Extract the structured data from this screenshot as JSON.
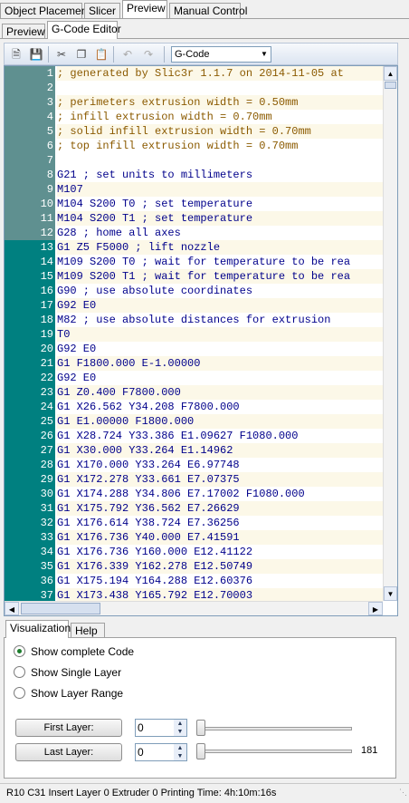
{
  "main_tabs": [
    {
      "label": "Object Placement"
    },
    {
      "label": "Slicer"
    },
    {
      "label": "Preview"
    },
    {
      "label": "Manual Control"
    }
  ],
  "sub_tabs": [
    {
      "label": "Preview"
    },
    {
      "label": "G-Code Editor"
    }
  ],
  "toolbar": {
    "icons": [
      "new-file",
      "save",
      "cut",
      "copy",
      "paste",
      "undo",
      "redo"
    ],
    "combo_value": "G-Code"
  },
  "editor": {
    "lines": [
      {
        "n": "1",
        "text": "; generated by Slic3r 1.1.7 on 2014-11-05 at"
      },
      {
        "n": "2",
        "text": ""
      },
      {
        "n": "3",
        "text": "; perimeters extrusion width = 0.50mm"
      },
      {
        "n": "4",
        "text": "; infill extrusion width = 0.70mm"
      },
      {
        "n": "5",
        "text": "; solid infill extrusion width = 0.70mm"
      },
      {
        "n": "6",
        "text": "; top infill extrusion width = 0.70mm"
      },
      {
        "n": "7",
        "text": ""
      },
      {
        "n": "8",
        "text": "G21 ; set units to millimeters"
      },
      {
        "n": "9",
        "text": "M107"
      },
      {
        "n": "10",
        "text": "M104 S200 T0 ; set temperature"
      },
      {
        "n": "11",
        "text": "M104 S200 T1 ; set temperature"
      },
      {
        "n": "12",
        "text": "G28 ; home all axes"
      },
      {
        "n": "13",
        "text": "G1 Z5 F5000 ; lift nozzle"
      },
      {
        "n": "14",
        "text": "M109 S200 T0 ; wait for temperature to be rea"
      },
      {
        "n": "15",
        "text": "M109 S200 T1 ; wait for temperature to be rea"
      },
      {
        "n": "16",
        "text": "G90 ; use absolute coordinates"
      },
      {
        "n": "17",
        "text": "G92 E0"
      },
      {
        "n": "18",
        "text": "M82 ; use absolute distances for extrusion"
      },
      {
        "n": "19",
        "text": "T0"
      },
      {
        "n": "20",
        "text": "G92 E0"
      },
      {
        "n": "21",
        "text": "G1 F1800.000 E-1.00000"
      },
      {
        "n": "22",
        "text": "G92 E0"
      },
      {
        "n": "23",
        "text": "G1 Z0.400 F7800.000"
      },
      {
        "n": "24",
        "text": "G1 X26.562 Y34.208 F7800.000"
      },
      {
        "n": "25",
        "text": "G1 E1.00000 F1800.000"
      },
      {
        "n": "26",
        "text": "G1 X28.724 Y33.386 E1.09627 F1080.000"
      },
      {
        "n": "27",
        "text": "G1 X30.000 Y33.264 E1.14962"
      },
      {
        "n": "28",
        "text": "G1 X170.000 Y33.264 E6.97748"
      },
      {
        "n": "29",
        "text": "G1 X172.278 Y33.661 E7.07375"
      },
      {
        "n": "30",
        "text": "G1 X174.288 Y34.806 E7.17002 F1080.000"
      },
      {
        "n": "31",
        "text": "G1 X175.792 Y36.562 E7.26629"
      },
      {
        "n": "32",
        "text": "G1 X176.614 Y38.724 E7.36256"
      },
      {
        "n": "33",
        "text": "G1 X176.736 Y40.000 E7.41591"
      },
      {
        "n": "34",
        "text": "G1 X176.736 Y160.000 E12.41122"
      },
      {
        "n": "35",
        "text": "G1 X176.339 Y162.278 E12.50749"
      },
      {
        "n": "36",
        "text": "G1 X175.194 Y164.288 E12.60376"
      },
      {
        "n": "37",
        "text": "G1 X173.438 Y165.792 E12.70003"
      }
    ]
  },
  "bottom_tabs": [
    {
      "label": "Visualization"
    },
    {
      "label": "Help"
    }
  ],
  "visualization": {
    "options": [
      {
        "label": "Show complete Code",
        "selected": true
      },
      {
        "label": "Show Single Layer",
        "selected": false
      },
      {
        "label": "Show Layer Range",
        "selected": false
      }
    ],
    "first_layer": {
      "button": "First Layer:",
      "value": "0"
    },
    "last_layer": {
      "button": "Last Layer:",
      "value": "0",
      "max_label": "181"
    }
  },
  "statusbar": {
    "text": "R10  C31  Insert  Layer 0  Extruder 0  Printing Time: 4h:10m:16s"
  },
  "colors": {
    "gutter_header": "#5f9090",
    "gutter_body": "#008080",
    "comment": "#8b5a00",
    "command": "#00008b"
  }
}
